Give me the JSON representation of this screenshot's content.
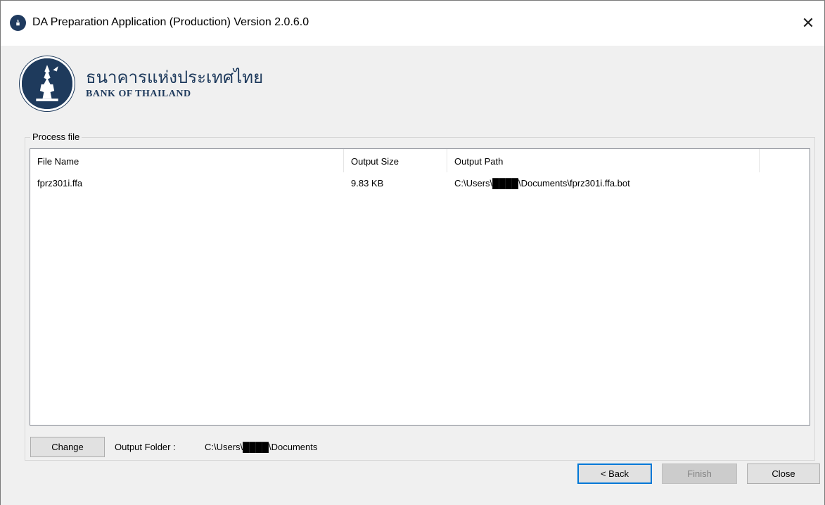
{
  "window": {
    "title": "DA Preparation Application (Production) Version 2.0.6.0",
    "close_glyph": "✕"
  },
  "branding": {
    "thai_name": "ธนาคารแห่งประเทศไทย",
    "english_name": "BANK OF THAILAND",
    "brand_color": "#1e3a5c"
  },
  "process_group": {
    "legend": "Process file",
    "columns": [
      "File Name",
      "Output Size",
      "Output Path"
    ],
    "rows": [
      {
        "file_name": "fprz301i.ffa",
        "output_size": "9.83 KB",
        "output_path": "C:\\Users\\████\\Documents\\fprz301i.ffa.bot"
      }
    ]
  },
  "output_folder": {
    "button_label": "Change",
    "label": "Output Folder :",
    "value": "C:\\Users\\████\\Documents"
  },
  "footer": {
    "back_label": "< Back",
    "finish_label": "Finish",
    "close_label": "Close"
  }
}
